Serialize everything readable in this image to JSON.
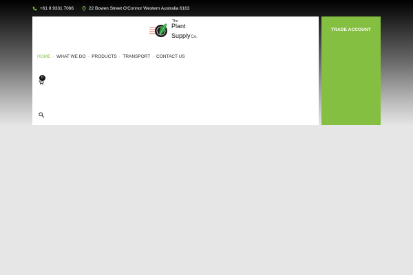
{
  "topbar": {
    "phone": "+61 8 9331 7066",
    "address": "22 Bowen Street O'Connor Western Australia 6163",
    "phone_icon": "phone-icon",
    "address_icon": "map-pin-icon"
  },
  "logo": {
    "line1": "The",
    "line2": "Plant",
    "line3": "Supply",
    "line4": "Co."
  },
  "nav": {
    "items": [
      {
        "label": "HOME",
        "active": true
      },
      {
        "label": "WHAT WE DO",
        "active": false
      },
      {
        "label": "PRODUCTS",
        "active": false
      },
      {
        "label": "TRANSPORT",
        "active": false
      },
      {
        "label": "CONTACT US",
        "active": false
      }
    ],
    "separator": "‹"
  },
  "cart": {
    "count": "0",
    "icon": "cart-icon"
  },
  "search": {
    "icon": "search-icon"
  },
  "trade": {
    "label": "TRADE ACCOUNT"
  },
  "colors": {
    "accent": "#85bf42",
    "background": "#e6e6e6",
    "card": "#ffffff"
  }
}
